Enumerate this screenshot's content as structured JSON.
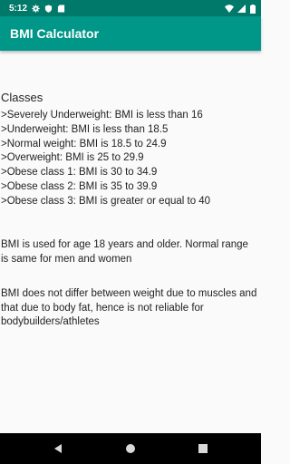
{
  "status_bar": {
    "time": "5:12",
    "left_icons": [
      "gear-icon",
      "shield-icon",
      "sd-card-icon"
    ],
    "right_icons": [
      "wifi-icon",
      "signal-icon",
      "battery-icon"
    ]
  },
  "app_bar": {
    "title": "BMI Calculator",
    "color": "#009688",
    "status_color": "#00796b"
  },
  "content": {
    "classes_heading": "Classes",
    "classes": [
      ">Severely Underweight: BMI is less than 16",
      ">Underweight: BMI is less than 18.5",
      ">Normal weight: BMI is 18.5 to 24.9",
      ">Overweight: BMI is 25 to 29.9",
      ">Obese class 1: BMI is 30 to 34.9",
      ">Obese class 2: BMI is 35 to 39.9",
      ">Obese class 3: BMI is greater or equal to 40"
    ],
    "paragraph_1": "BMI is used for age 18 years and older. Normal range is same for men and women",
    "paragraph_2": "BMI does not differ between weight due to muscles and that due to body fat, hence is not reliable for bodybuilders/athletes"
  },
  "nav_bar": {
    "buttons": [
      "back-icon",
      "home-icon",
      "recents-icon"
    ]
  }
}
